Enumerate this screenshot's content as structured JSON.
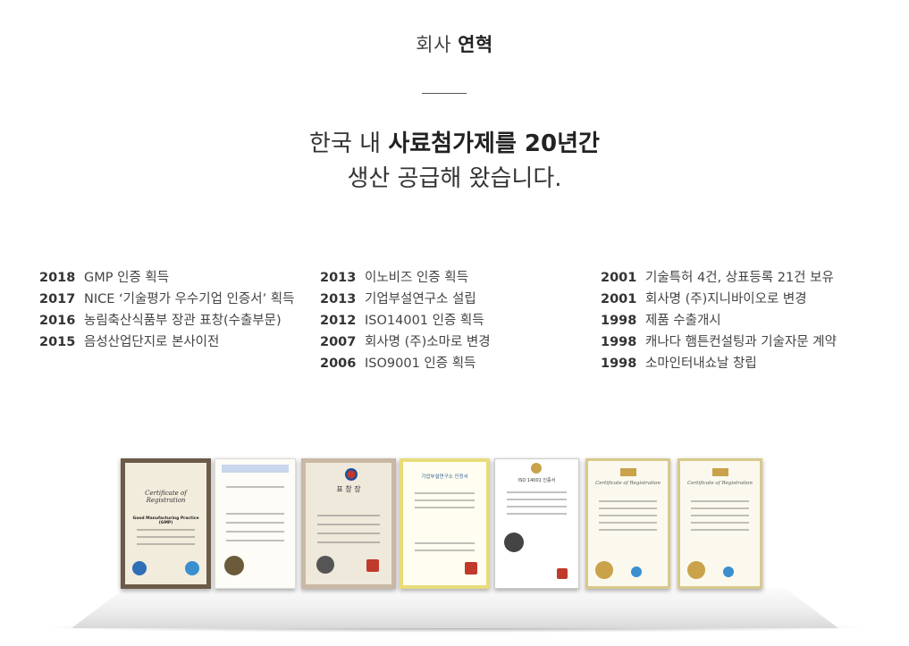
{
  "header": {
    "title_normal": "회사 ",
    "title_bold": "연혁"
  },
  "headline": {
    "line1_normal": "한국 내 ",
    "line1_bold": "사료첨가제를",
    "line1_end": " 20년간",
    "line2": "생산 공급해 왔습니다."
  },
  "history": {
    "col1": [
      {
        "year": "2018",
        "event": "GMP 인증 획득"
      },
      {
        "year": "2017",
        "event": "NICE ‘기술평가 우수기업 인증서’ 획득"
      },
      {
        "year": "2016",
        "event": "농림축산식품부 장관 표창(수출부문)"
      },
      {
        "year": "2015",
        "event": "음성산업단지로 본사이전"
      }
    ],
    "col2": [
      {
        "year": "2013",
        "event": "이노비즈 인증 획득"
      },
      {
        "year": "2013",
        "event": "기업부설연구소 설립"
      },
      {
        "year": "2012",
        "event": "ISO14001 인증 획득"
      },
      {
        "year": "2007",
        "event": "회사명 (주)소마로 변경"
      },
      {
        "year": "2006",
        "event": "ISO9001 인증 획득"
      }
    ],
    "col3": [
      {
        "year": "2001",
        "event": "기술특허 4건, 상표등록 21건 보유"
      },
      {
        "year": "2001",
        "event": "회사명 (주)지니바이오로 변경"
      },
      {
        "year": "1998",
        "event": "제품 수출개시"
      },
      {
        "year": "1998",
        "event": "캐나다 햄튼컨설팅과 기술자문 계약"
      },
      {
        "year": "1998",
        "event": "소마인터내쇼날 창립"
      }
    ]
  },
  "certificates": {
    "cert1_title": "Certificate of Registration",
    "cert1_line": "Good Manufacturing Practice (GMP)",
    "cert3_title": "표 창 장",
    "cert4_title": "기업부설연구소 인정서",
    "cert5_title": "ISO 14001 인증서",
    "cert6_title": "Certificate of Registration",
    "cert7_title": "Certificate of Registration",
    "colors": {
      "frame_dark": "#6d5b4a",
      "gold_frame": "#d8c98c",
      "seal_red": "#c0392b"
    }
  }
}
